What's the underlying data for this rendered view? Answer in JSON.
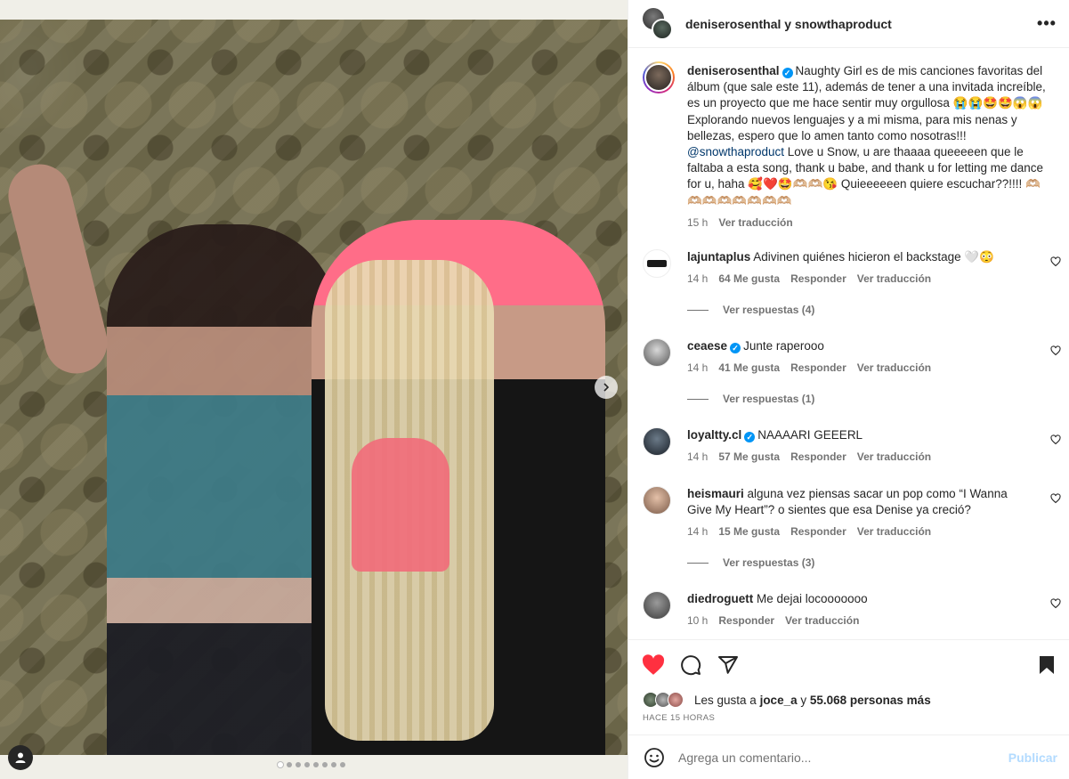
{
  "header": {
    "title": "deniserosenthal y snowthaproduct",
    "more_label": "•••"
  },
  "caption": {
    "username": "deniserosenthal",
    "text_1": "Naughty Girl es de mis canciones favoritas del álbum (que sale este 11), además de tener a una invitada increíble, es un proyecto que me hace sentir muy orgullosa 😭😭🤩🤩😱😱 Explorando nuevos lenguajes y a mi misma, para mis nenas y bellezas, espero que lo amen tanto como nosotras!!!",
    "mention": "@snowthaproduct",
    "text_2": " Love u Snow, u are thaaaa queeeeen que le faltaba a esta song, thank u babe, and thank u for letting me dance for u, haha 🥰❤️🤩🫶🏼🫶🏼😘 Quieeeeeen quiere escuchar??!!!! 🫶🏼🫶🏼🫶🏼🫶🏼🫶🏼🫶🏼🫶🏼🫶🏼",
    "time": "15 h",
    "translate": "Ver traducción"
  },
  "comments": [
    {
      "username": "lajuntaplus",
      "verified": false,
      "text": "Adivinen quiénes hicieron el backstage 🤍😳",
      "time": "14 h",
      "likes": "64 Me gusta",
      "reply": "Responder",
      "translate": "Ver traducción",
      "replies": "Ver respuestas (4)"
    },
    {
      "username": "ceaese",
      "verified": true,
      "text": "Junte raperooo",
      "time": "14 h",
      "likes": "41 Me gusta",
      "reply": "Responder",
      "translate": "Ver traducción",
      "replies": "Ver respuestas (1)"
    },
    {
      "username": "loyaltty.cl",
      "verified": true,
      "text": "NAAAARI GEEERL",
      "time": "14 h",
      "likes": "57 Me gusta",
      "reply": "Responder",
      "translate": "Ver traducción"
    },
    {
      "username": "heismauri",
      "verified": false,
      "text": "alguna vez piensas sacar un pop como “I Wanna Give My Heart”? o sientes que esa Denise ya creció?",
      "time": "14 h",
      "likes": "15 Me gusta",
      "reply": "Responder",
      "translate": "Ver traducción",
      "replies": "Ver respuestas (3)"
    },
    {
      "username": "diedroguett",
      "verified": false,
      "text": "Me dejai locooooooo",
      "time": "10 h",
      "reply": "Responder",
      "translate": "Ver traducción"
    }
  ],
  "likes": {
    "prefix": "Les gusta a ",
    "user": "joce_a",
    "middle": " y ",
    "count": "55.068 personas más"
  },
  "time_ago": "HACE 15 HORAS",
  "add_comment": {
    "placeholder": "Agrega un comentario...",
    "publish": "Publicar"
  },
  "colors": {
    "accent": "#0095f6",
    "like_red": "#ff3040",
    "text": "#262626",
    "muted": "#737373"
  },
  "icons": [
    "more-icon",
    "verified-icon",
    "heart-icon",
    "comment-icon",
    "share-icon",
    "bookmark-icon",
    "emoji-icon",
    "chevron-right-icon",
    "user-tag-icon"
  ]
}
